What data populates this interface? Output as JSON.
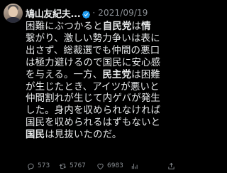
{
  "author": {
    "name": "鳩山友紀夫...",
    "verified": true,
    "date": "2021/09/19"
  },
  "tweet_lines": [
    [
      {
        "t": "困難にぶつかると"
      },
      {
        "t": "自民党",
        "b": true
      },
      {
        "t": "は"
      },
      {
        "t": "情",
        "b": true
      }
    ],
    [
      {
        "t": "繋がり、激しい勢力争いは表に"
      }
    ],
    [
      {
        "t": "出さず、総裁選でも仲間の悪口"
      }
    ],
    [
      {
        "t": "は極力避けるので国民に安心感"
      }
    ],
    [
      {
        "t": "を与える。一方、"
      },
      {
        "t": "民主党",
        "b": true
      },
      {
        "t": "は困難"
      }
    ],
    [
      {
        "t": "が生じたとき、アイツが悪いと"
      }
    ],
    [
      {
        "t": "仲間割れが生じて内ゲバが発生"
      }
    ],
    [
      {
        "t": "した。身内を収められなければ"
      }
    ],
    [
      {
        "t": "国民を収められるはずもないと"
      }
    ],
    [
      {
        "t": "国民",
        "b": true
      },
      {
        "t": "は見抜いたのだ。"
      }
    ]
  ],
  "stats": {
    "replies": "573",
    "retweets": "5767",
    "likes": "6983"
  },
  "icons": {
    "reply": "reply-icon",
    "retweet": "retweet-icon",
    "like": "like-icon",
    "views": "views-icon",
    "share": "share-icon",
    "verified": "verified-badge-icon"
  },
  "colors": {
    "background": "#000000",
    "text": "#e7e9ea",
    "secondary": "#8b9095",
    "verified": "#1d9bf0"
  }
}
